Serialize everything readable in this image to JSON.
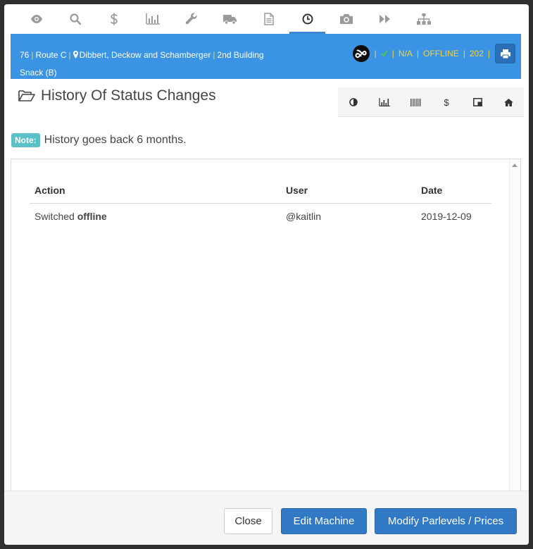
{
  "tabs": [
    {
      "icon": "eye-icon",
      "active": false
    },
    {
      "icon": "search-icon",
      "active": false
    },
    {
      "icon": "dollar-icon",
      "active": false
    },
    {
      "icon": "bar-chart-icon",
      "active": false
    },
    {
      "icon": "wrench-icon",
      "active": false
    },
    {
      "icon": "truck-icon",
      "active": false
    },
    {
      "icon": "document-icon",
      "active": false
    },
    {
      "icon": "clock-icon",
      "active": true
    },
    {
      "icon": "camera-icon",
      "active": false
    },
    {
      "icon": "fast-forward-icon",
      "active": false
    },
    {
      "icon": "sitemap-icon",
      "active": false
    }
  ],
  "header": {
    "machine_number": "76",
    "route": "Route C",
    "location": "Dibbert, Deckow and Schamberger",
    "place": "2nd Building Snack (B)",
    "na": "N/A",
    "status": "OFFLINE",
    "code": "202",
    "separator": "|"
  },
  "section": {
    "title": "History Of Status Changes"
  },
  "toolbar": [
    "half-circle-icon",
    "bar-chart-icon",
    "barcode-icon",
    "dollar-icon",
    "columns-icon",
    "home-icon"
  ],
  "toolbar_dollar": "$",
  "note": {
    "badge": "Note:",
    "text": "History goes back 6 months."
  },
  "table": {
    "columns": [
      "Action",
      "User",
      "Date"
    ],
    "rows": [
      {
        "action_prefix": "Switched",
        "action_bold": "offline",
        "user": "@kaitlin",
        "date": "2019-12-09"
      }
    ]
  },
  "footer": {
    "close": "Close",
    "edit": "Edit Machine",
    "modify": "Modify Parlevels / Prices"
  },
  "colors": {
    "header_bg": "#3b93e3",
    "primary_button": "#3179c5",
    "note_badge": "#5bc0c8",
    "status_yellow": "#f5d442",
    "check_green": "#3ecf4b"
  }
}
